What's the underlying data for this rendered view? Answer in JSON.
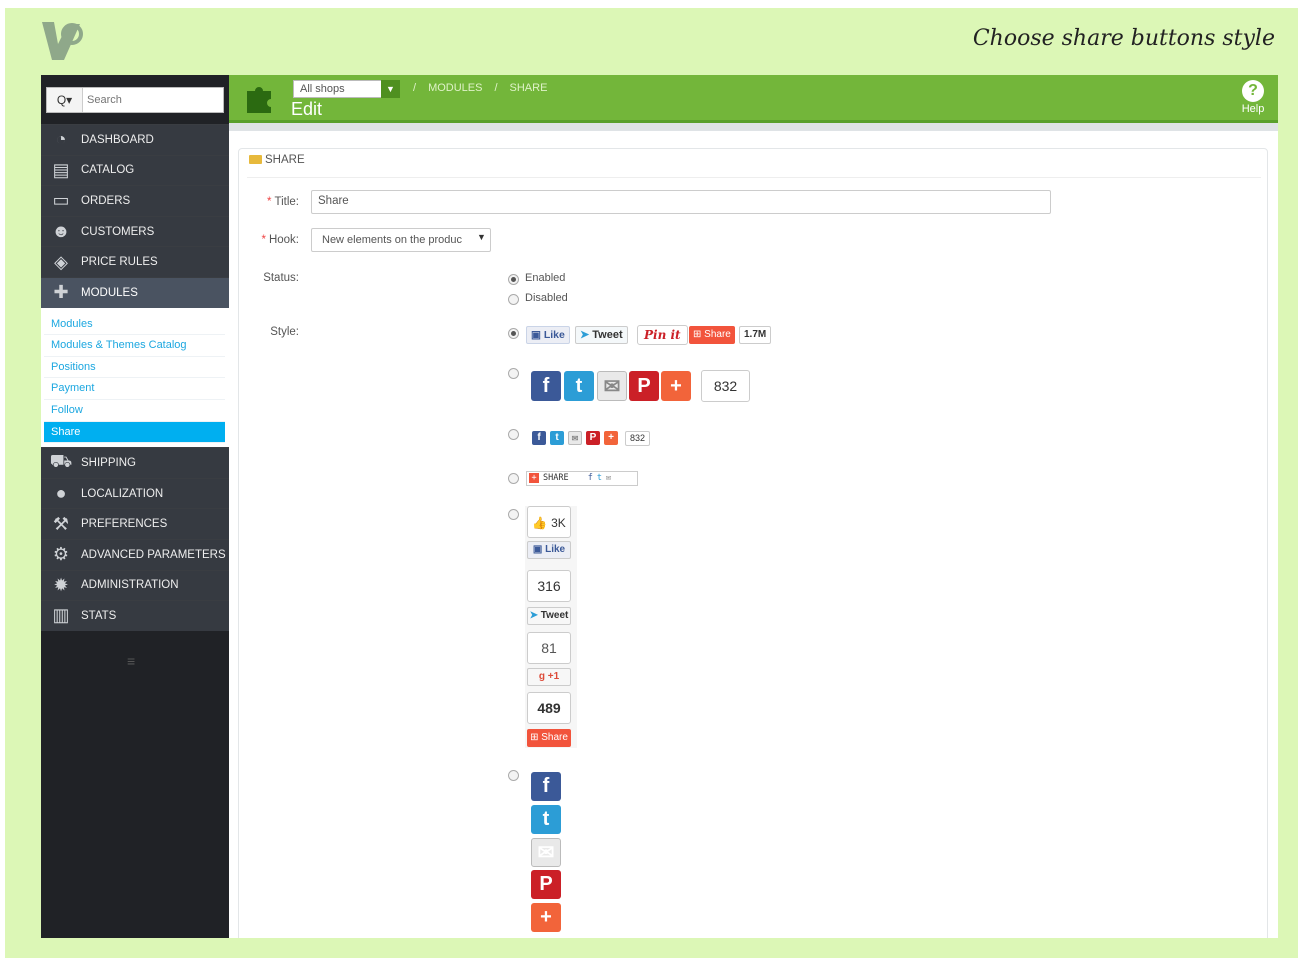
{
  "headline": "Choose share buttons style",
  "search": {
    "placeholder": "Search",
    "button_label": "Q▾"
  },
  "sidebar": {
    "items_top": [
      {
        "label": "DASHBOARD",
        "icon": "dashboard-icon"
      },
      {
        "label": "CATALOG",
        "icon": "catalog-icon"
      },
      {
        "label": "ORDERS",
        "icon": "orders-icon"
      },
      {
        "label": "CUSTOMERS",
        "icon": "customers-icon"
      },
      {
        "label": "PRICE RULES",
        "icon": "price-rules-icon"
      },
      {
        "label": "MODULES",
        "icon": "modules-icon",
        "active": true
      }
    ],
    "submenu": [
      "Modules",
      "Modules & Themes Catalog",
      "Positions",
      "Payment",
      "Follow",
      "Share"
    ],
    "submenu_active": "Share",
    "items_bottom": [
      {
        "label": "SHIPPING",
        "icon": "shipping-icon"
      },
      {
        "label": "LOCALIZATION",
        "icon": "localization-icon"
      },
      {
        "label": "PREFERENCES",
        "icon": "preferences-icon"
      },
      {
        "label": "ADVANCED PARAMETERS",
        "icon": "advanced-parameters-icon"
      },
      {
        "label": "ADMINISTRATION",
        "icon": "administration-icon"
      },
      {
        "label": "STATS",
        "icon": "stats-icon"
      }
    ]
  },
  "header": {
    "shop_select": "All shops",
    "breadcrumb": [
      "MODULES",
      "SHARE"
    ],
    "title": "Edit",
    "help_label": "Help"
  },
  "panel": {
    "heading": "SHARE",
    "title_label": "Title:",
    "title_value": "Share",
    "hook_label": "Hook:",
    "hook_value": "New elements on the produc",
    "status_label": "Status:",
    "status_options": [
      "Enabled",
      "Disabled"
    ],
    "status_selected": "Enabled",
    "style_label": "Style:"
  },
  "styles": {
    "style1": {
      "like": "Like",
      "tweet": "Tweet",
      "pin": "Pin it",
      "share": "Share",
      "count": "1.7M"
    },
    "style2": {
      "count": "832"
    },
    "style3": {
      "count": "832"
    },
    "style4": {
      "share": "SHARE"
    },
    "style5": {
      "likes": "3K",
      "like": "Like",
      "tweets": "316",
      "tweet": "Tweet",
      "gplus": "81",
      "gplus_btn": "+1",
      "shares": "489",
      "share": "Share"
    }
  },
  "colors": {
    "header_green": "#73b63a",
    "sidebar_dark": "#363a41",
    "active_blue": "#00aff0",
    "frame_green": "#dcf7b6"
  }
}
